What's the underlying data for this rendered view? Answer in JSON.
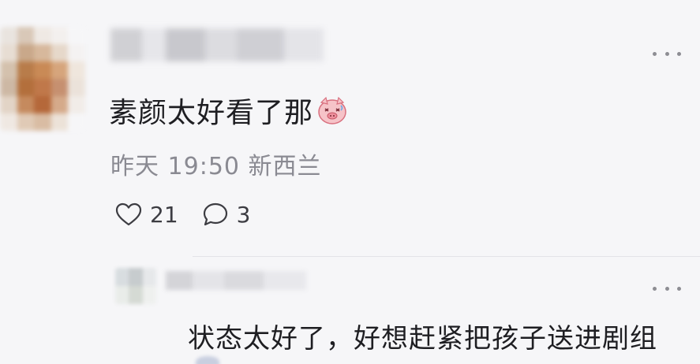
{
  "comment": {
    "text": "素颜太好看了那",
    "sticker_icon": "pig-face-sticker-icon",
    "meta": "昨天 19:50 新西兰",
    "likes": "21",
    "replies": "3",
    "like_icon": "heart-outline-icon",
    "reply_icon": "speech-bubble-icon",
    "more_icon": "more-dots-icon"
  },
  "reply": {
    "text": "状态太好了，好想赶紧把孩子送进剧组",
    "more_icon": "more-dots-icon"
  },
  "colors": {
    "background": "#f6f6f8",
    "text_primary": "#1e1e22",
    "text_secondary": "#8a8a92",
    "icon": "#3c3c42",
    "sticker_pink": "#f2a9b2"
  }
}
